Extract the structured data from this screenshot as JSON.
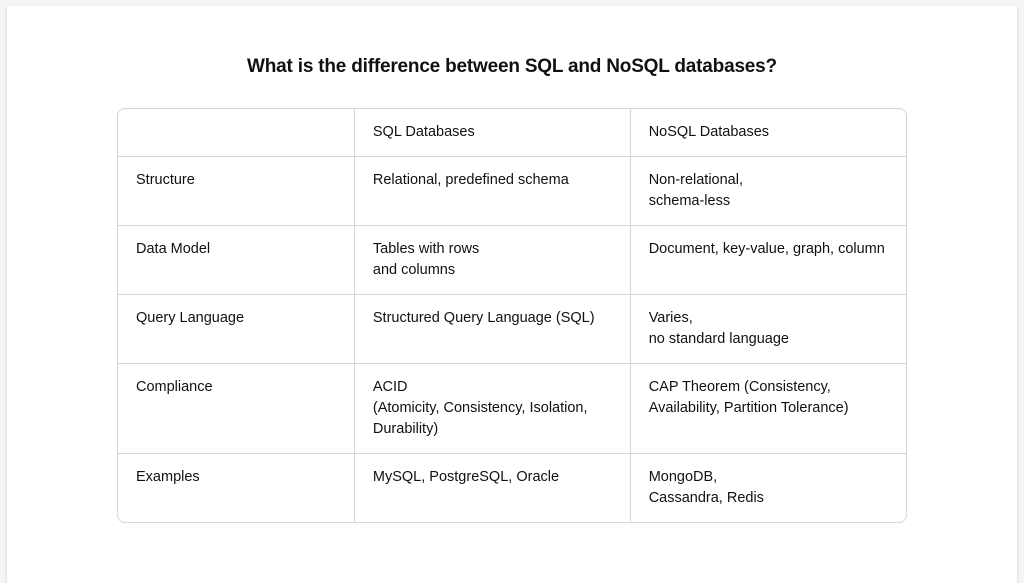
{
  "title": "What is the difference between SQL and NoSQL databases?",
  "columns": {
    "blank": "",
    "sql": "SQL Databases",
    "nosql": "NoSQL Databases"
  },
  "rows": [
    {
      "aspect": "Structure",
      "sql": "Relational, predefined schema",
      "nosql": "Non-relational,\nschema-less"
    },
    {
      "aspect": "Data Model",
      "sql": "Tables with rows\nand columns",
      "nosql": "Document, key-value, graph, column"
    },
    {
      "aspect": "Query Language",
      "sql": "Structured Query Language (SQL)",
      "nosql": "Varies,\nno standard language"
    },
    {
      "aspect": "Compliance",
      "sql": "ACID\n(Atomicity, Consistency, Isolation, Durability)",
      "nosql": "CAP Theorem (Consistency, Availability, Partition Tolerance)"
    },
    {
      "aspect": "Examples",
      "sql": "MySQL, PostgreSQL, Oracle",
      "nosql": "MongoDB,\nCassandra, Redis"
    }
  ]
}
